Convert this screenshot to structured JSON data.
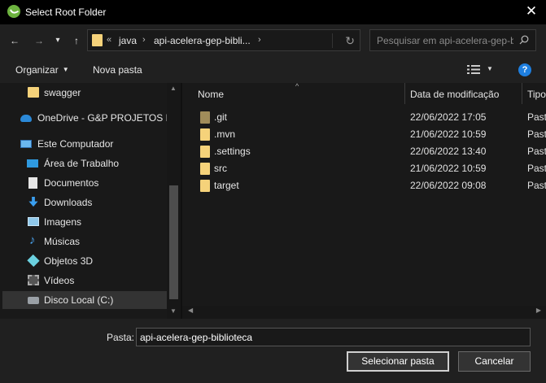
{
  "window": {
    "title": "Select Root Folder",
    "close_glyph": "✕"
  },
  "navigation": {
    "back_glyph": "←",
    "forward_glyph": "→",
    "recent_glyph": "▾",
    "up_glyph": "↑"
  },
  "address": {
    "overflow": "«",
    "segments": [
      "java",
      "api-acelera-gep-bibli..."
    ],
    "separator": "›",
    "refresh_glyph": "↻"
  },
  "search": {
    "placeholder": "Pesquisar em api-acelera-gep-biblioteca"
  },
  "toolbar": {
    "organize": "Organizar",
    "new_folder": "Nova pasta",
    "help": "?"
  },
  "sidebar": {
    "items": [
      {
        "label": "swagger",
        "icon": "folder-icon"
      },
      {
        "label": "OneDrive - G&P PROJETOS E S",
        "icon": "cloud-icon"
      },
      {
        "label": "Este Computador",
        "icon": "computer-icon"
      },
      {
        "label": "Área de Trabalho",
        "icon": "desktop-icon"
      },
      {
        "label": "Documentos",
        "icon": "document-icon"
      },
      {
        "label": "Downloads",
        "icon": "download-icon"
      },
      {
        "label": "Imagens",
        "icon": "pictures-icon"
      },
      {
        "label": "Músicas",
        "icon": "music-icon"
      },
      {
        "label": "Objetos 3D",
        "icon": "3d-objects-icon"
      },
      {
        "label": "Vídeos",
        "icon": "videos-icon"
      },
      {
        "label": "Disco Local (C:)",
        "icon": "drive-icon"
      }
    ]
  },
  "files": {
    "columns": [
      "Nome",
      "Data de modificação",
      "Tipo"
    ],
    "rows": [
      {
        "name": ".git",
        "modified": "22/06/2022 17:05",
        "type": "Past"
      },
      {
        "name": ".mvn",
        "modified": "21/06/2022 10:59",
        "type": "Past"
      },
      {
        "name": ".settings",
        "modified": "22/06/2022 13:40",
        "type": "Past"
      },
      {
        "name": "src",
        "modified": "21/06/2022 10:59",
        "type": "Past"
      },
      {
        "name": "target",
        "modified": "22/06/2022 09:08",
        "type": "Past"
      }
    ]
  },
  "footer": {
    "folder_label": "Pasta:",
    "folder_value": "api-acelera-gep-biblioteca",
    "select_button": "Selecionar pasta",
    "cancel_button": "Cancelar"
  },
  "colors": {
    "accent": "#1e7fe0",
    "folder": "#f5d27a",
    "background": "#191919"
  }
}
